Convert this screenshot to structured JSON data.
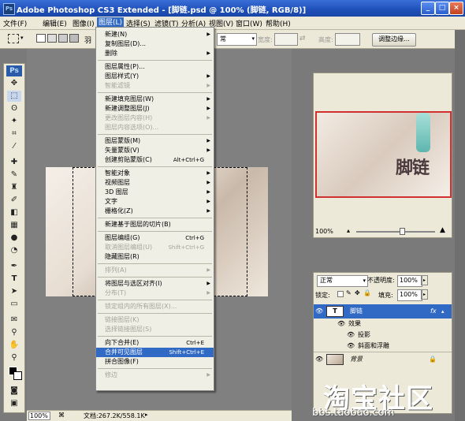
{
  "window": {
    "app_icon": "Ps",
    "title": "Adobe Photoshop CS3 Extended - [脚链.psd @ 100% (脚链, RGB/8)]",
    "min": "_",
    "max": "□",
    "close": "×"
  },
  "menubar": [
    {
      "label": "文件(F)"
    },
    {
      "label": "编辑(E)"
    },
    {
      "label": "图像(I)"
    },
    {
      "label": "图层(L)",
      "active": true
    },
    {
      "label": "选择(S)"
    },
    {
      "label": "滤镜(T)"
    },
    {
      "label": "分析(A)"
    },
    {
      "label": "视图(V)"
    },
    {
      "label": "窗口(W)"
    },
    {
      "label": "帮助(H)"
    }
  ],
  "optbar": {
    "feather_label": "羽",
    "width_label": "宽度:",
    "height_label": "高度:",
    "refine_button": "调整边缘...",
    "style_value": "常"
  },
  "toolbox": {
    "logo": "Ps"
  },
  "dropdown": {
    "items": [
      {
        "label": "新建(N)",
        "arrow": true
      },
      {
        "label": "复制图层(D)..."
      },
      {
        "label": "删除",
        "arrow": true
      },
      {
        "sep": true
      },
      {
        "label": "图层属性(P)..."
      },
      {
        "label": "图层样式(Y)",
        "arrow": true
      },
      {
        "label": "智能滤镜",
        "disabled": true,
        "arrow": true
      },
      {
        "sep": true
      },
      {
        "label": "新建填充图层(W)",
        "arrow": true
      },
      {
        "label": "新建调整图层(J)",
        "arrow": true
      },
      {
        "label": "更改图层内容(H)",
        "disabled": true,
        "arrow": true
      },
      {
        "label": "图层内容选项(O)...",
        "disabled": true
      },
      {
        "sep": true
      },
      {
        "label": "图层蒙版(M)",
        "arrow": true
      },
      {
        "label": "矢量蒙版(V)",
        "arrow": true
      },
      {
        "label": "创建剪贴蒙版(C)",
        "shortcut": "Alt+Ctrl+G"
      },
      {
        "sep": true
      },
      {
        "label": "智能对象",
        "arrow": true
      },
      {
        "label": "视频图层",
        "arrow": true
      },
      {
        "label": "3D 图层",
        "arrow": true
      },
      {
        "label": "文字",
        "arrow": true
      },
      {
        "label": "栅格化(Z)",
        "arrow": true
      },
      {
        "sep": true
      },
      {
        "label": "新建基于图层的切片(B)"
      },
      {
        "sep": true
      },
      {
        "label": "图层编组(G)",
        "shortcut": "Ctrl+G"
      },
      {
        "label": "取消图层编组(U)",
        "shortcut": "Shift+Ctrl+G",
        "disabled": true
      },
      {
        "label": "隐藏图层(R)"
      },
      {
        "sep": true
      },
      {
        "label": "排列(A)",
        "disabled": true,
        "arrow": true
      },
      {
        "sep": true
      },
      {
        "label": "将图层与选区对齐(I)",
        "arrow": true
      },
      {
        "label": "分布(T)",
        "disabled": true,
        "arrow": true
      },
      {
        "sep": true
      },
      {
        "label": "锁定组内的所有图层(X)...",
        "disabled": true
      },
      {
        "sep": true
      },
      {
        "label": "链接图层(K)",
        "disabled": true
      },
      {
        "label": "选择链接图层(S)",
        "disabled": true
      },
      {
        "sep": true
      },
      {
        "label": "向下合并(E)",
        "shortcut": "Ctrl+E"
      },
      {
        "label": "合并可见图层",
        "shortcut": "Shift+Ctrl+E",
        "highlight": true
      },
      {
        "label": "拼合图像(F)"
      },
      {
        "sep": true
      },
      {
        "label": "修边",
        "disabled": true,
        "arrow": true
      }
    ]
  },
  "navigator": {
    "zoom": "100%",
    "thumb_text": "脚链"
  },
  "layers": {
    "blend_mode": "正常",
    "opacity_label": "不透明度:",
    "opacity": "100%",
    "lock_label": "锁定:",
    "fill_label": "填充:",
    "fill": "100%",
    "rows": [
      {
        "name": "脚链",
        "type": "text",
        "selected": true,
        "thumb": "T",
        "fx": "fx"
      },
      {
        "name": "效果",
        "indent": 1
      },
      {
        "name": "投影",
        "indent": 2
      },
      {
        "name": "斜面和浮雕",
        "indent": 2
      },
      {
        "name": "背景",
        "type": "image",
        "lock": "🔒"
      }
    ]
  },
  "status": {
    "zoom": "100%",
    "doc": "文档:267.2K/558.1K"
  },
  "watermark": {
    "big": "淘宝社区",
    "url": "bbs.taobao.com"
  }
}
